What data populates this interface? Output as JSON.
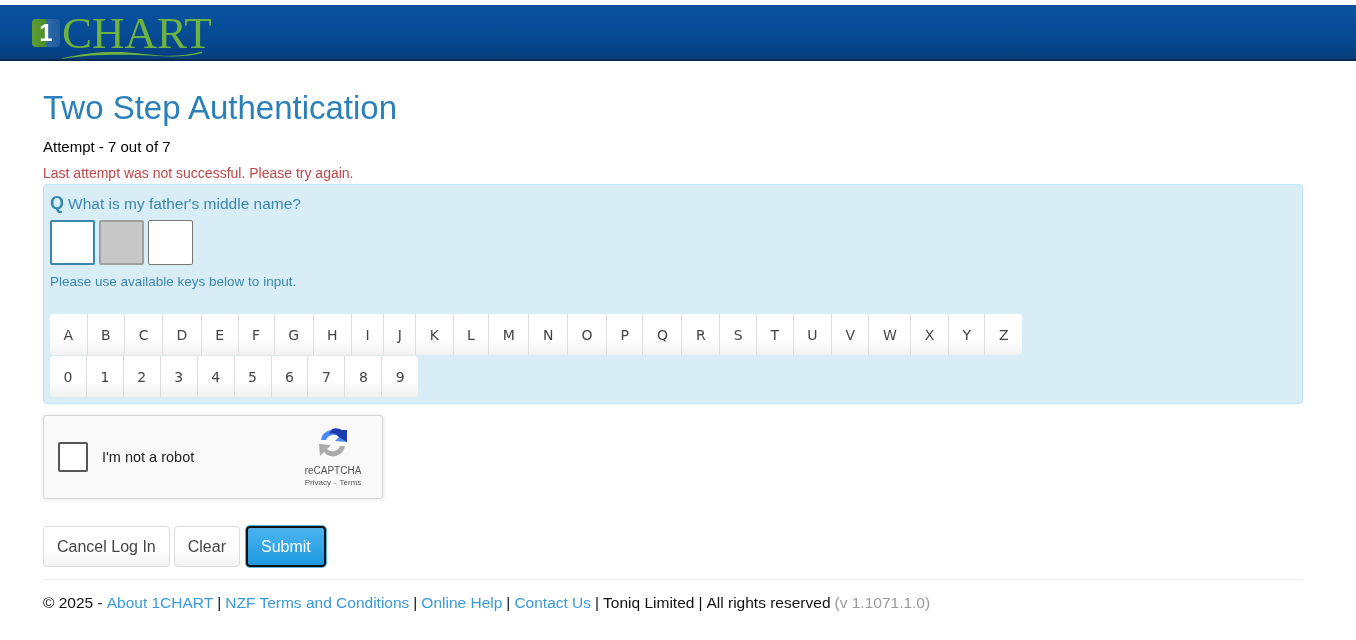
{
  "header": {
    "logo": {
      "tile_text": "1",
      "text": "CHART"
    }
  },
  "page": {
    "title": "Two Step Authentication",
    "attempt": "Attempt - 7 out of 7",
    "error": "Last attempt was not successful. Please try again."
  },
  "question_panel": {
    "prefix": "Q",
    "question": "What is my father's middle name?",
    "answer_boxes": [
      {
        "focused": true,
        "disabled": false
      },
      {
        "focused": false,
        "disabled": true
      },
      {
        "focused": false,
        "disabled": false
      }
    ],
    "hint": "Please use available keys below to input.",
    "keyboard": {
      "rows": [
        [
          "A",
          "B",
          "C",
          "D",
          "E",
          "F",
          "G",
          "H",
          "I",
          "J",
          "K",
          "L",
          "M",
          "N",
          "O",
          "P",
          "Q",
          "R",
          "S",
          "T",
          "U",
          "V",
          "W",
          "X",
          "Y",
          "Z"
        ],
        [
          "0",
          "1",
          "2",
          "3",
          "4",
          "5",
          "6",
          "7",
          "8",
          "9"
        ]
      ]
    }
  },
  "captcha": {
    "checked": false,
    "label": "I'm not a robot",
    "brand": "reCAPTCHA",
    "links": [
      {
        "kind": "link",
        "text": "Privacy"
      },
      {
        "kind": "text",
        "text": "-"
      },
      {
        "kind": "link",
        "text": "Terms"
      }
    ]
  },
  "buttons": [
    {
      "label": "Cancel Log In",
      "kind": "default",
      "focused": false
    },
    {
      "label": "Clear",
      "kind": "default",
      "focused": false
    },
    {
      "label": "Submit",
      "kind": "primary",
      "focused": true
    }
  ],
  "footer": [
    {
      "kind": "text",
      "text": "© 2025 -"
    },
    {
      "kind": "link",
      "text": "About 1CHART"
    },
    {
      "kind": "text",
      "text": "|"
    },
    {
      "kind": "link",
      "text": "NZF Terms and Conditions"
    },
    {
      "kind": "text",
      "text": "|"
    },
    {
      "kind": "link",
      "text": "Online Help"
    },
    {
      "kind": "text",
      "text": "|"
    },
    {
      "kind": "link",
      "text": "Contact Us"
    },
    {
      "kind": "text",
      "text": "|"
    },
    {
      "kind": "text",
      "text": "Toniq Limited"
    },
    {
      "kind": "text",
      "text": "|"
    },
    {
      "kind": "text",
      "text": "All rights reserved"
    },
    {
      "kind": "version",
      "text": "(v 1.1071.1.0)"
    }
  ]
}
